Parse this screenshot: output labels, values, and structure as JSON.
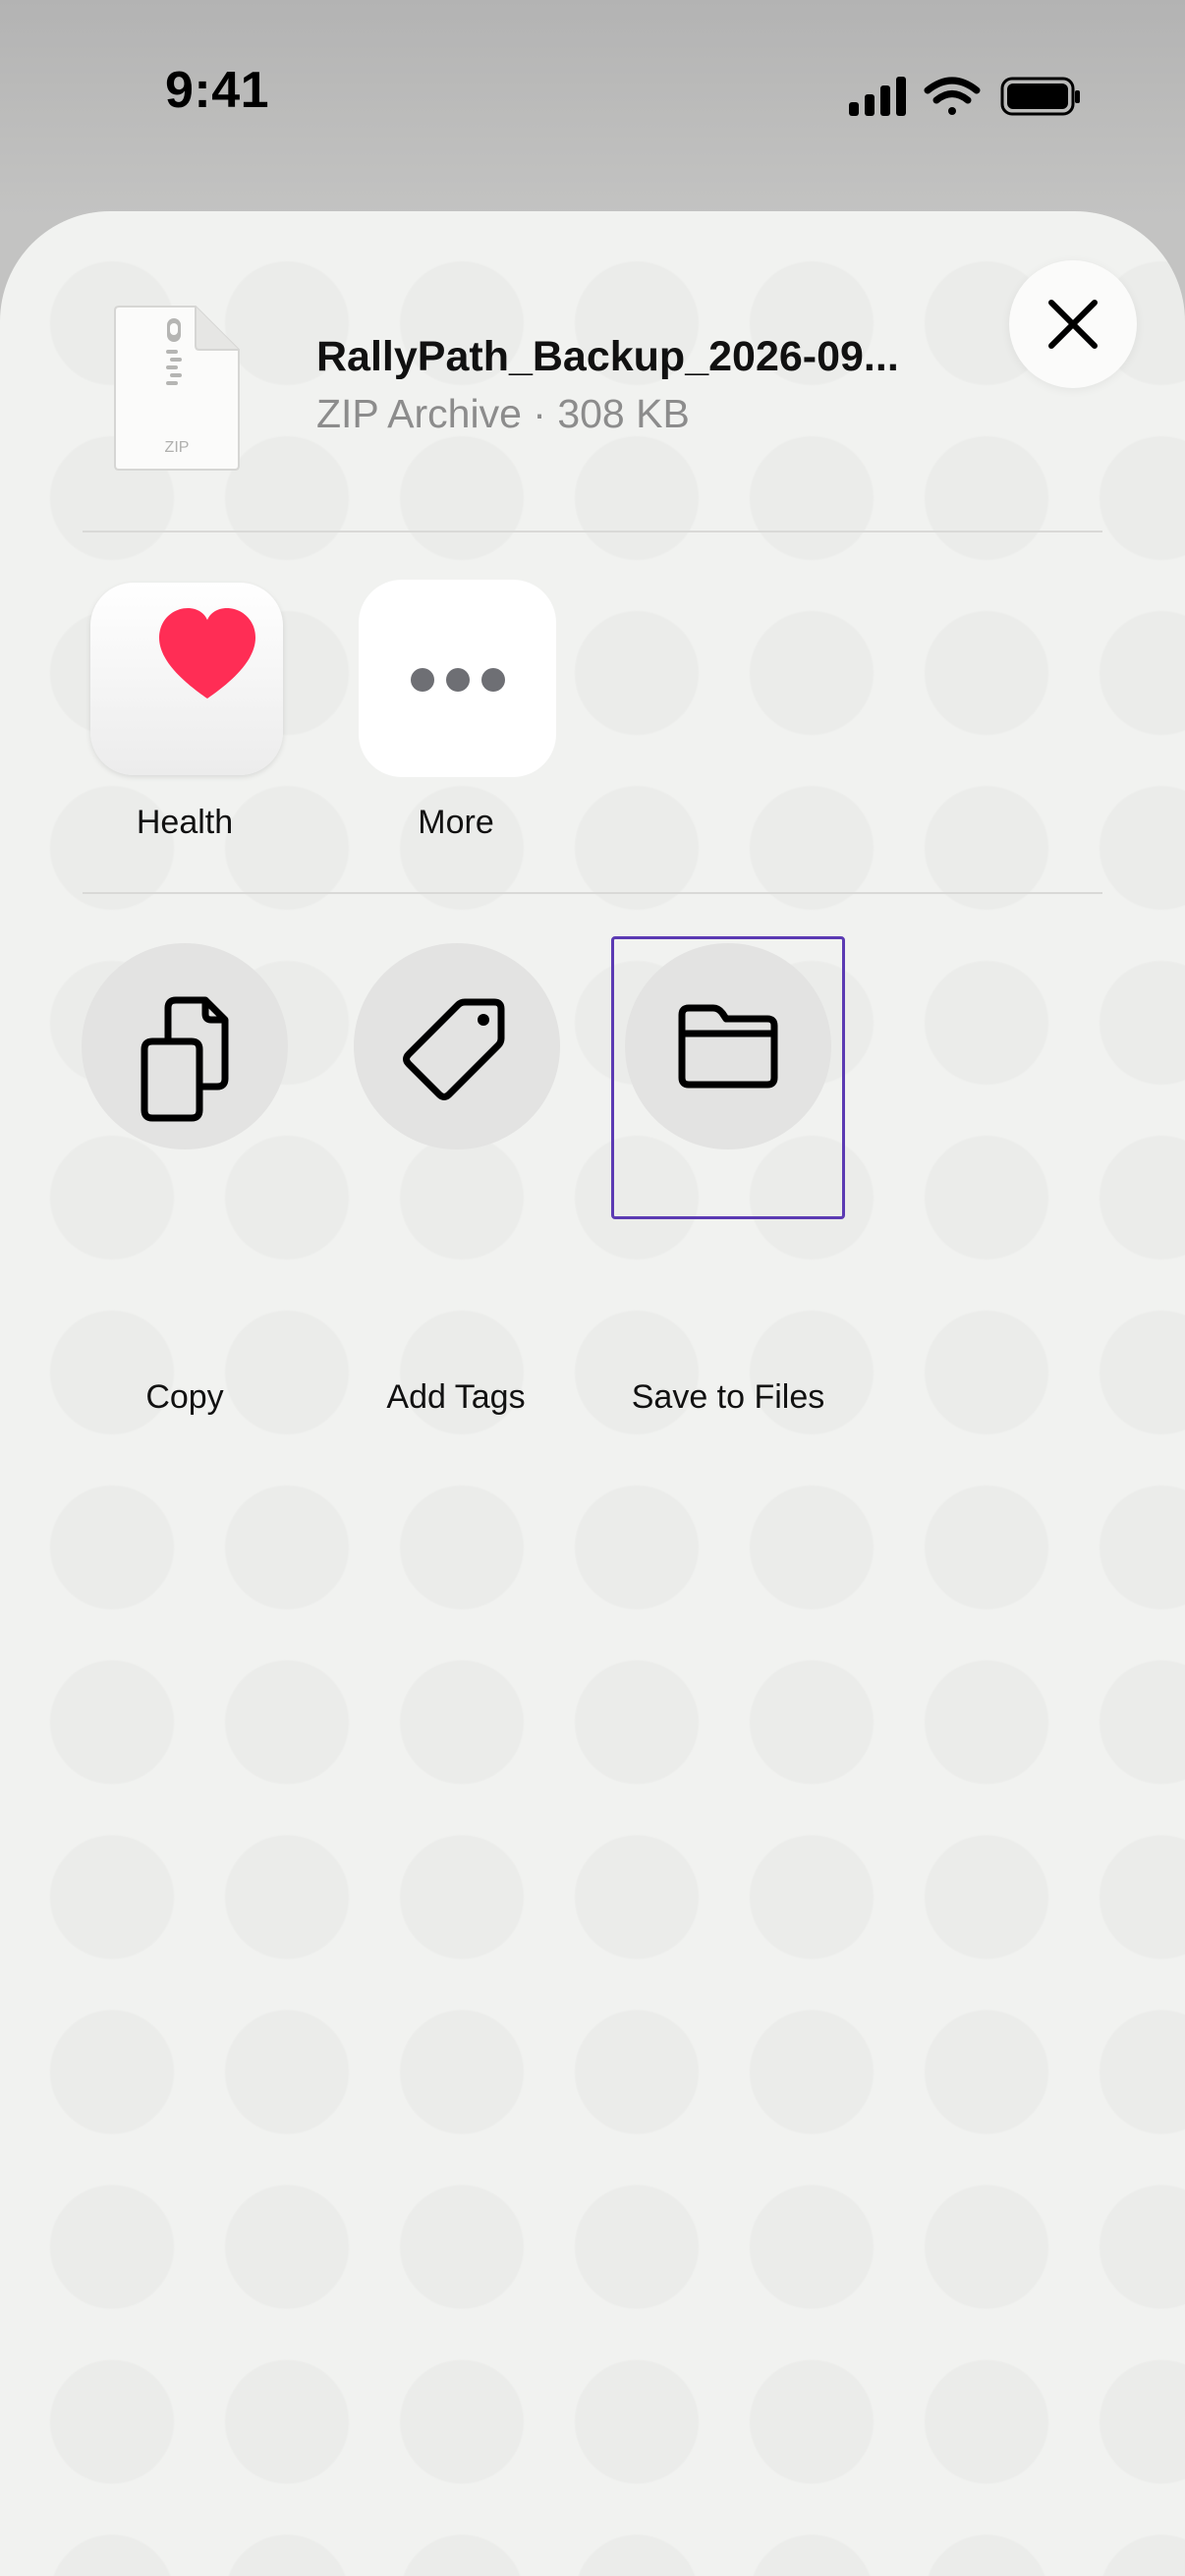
{
  "status_bar": {
    "time": "9:41",
    "icons": [
      "cellular-signal-icon",
      "wifi-icon",
      "battery-icon"
    ]
  },
  "share_sheet": {
    "file": {
      "name": "RallyPath_Backup_2026-09...",
      "meta": "ZIP Archive · 308 KB",
      "icon": "zip-file-icon",
      "icon_caption": "ZIP"
    },
    "close_icon": "close-icon",
    "apps": [
      {
        "label": "Health",
        "icon": "health-heart-icon"
      },
      {
        "label": "More",
        "icon": "more-ellipsis-icon"
      }
    ],
    "actions": [
      {
        "label": "Copy",
        "icon": "copy-icon"
      },
      {
        "label": "Add Tags",
        "icon": "tag-icon"
      },
      {
        "label": "Save to Files",
        "icon": "folder-icon",
        "highlighted": true
      }
    ]
  },
  "colors": {
    "highlight_border": "#5b3ab3",
    "heart": "#ff2d55",
    "sheet_background": "#f1f2f0"
  }
}
